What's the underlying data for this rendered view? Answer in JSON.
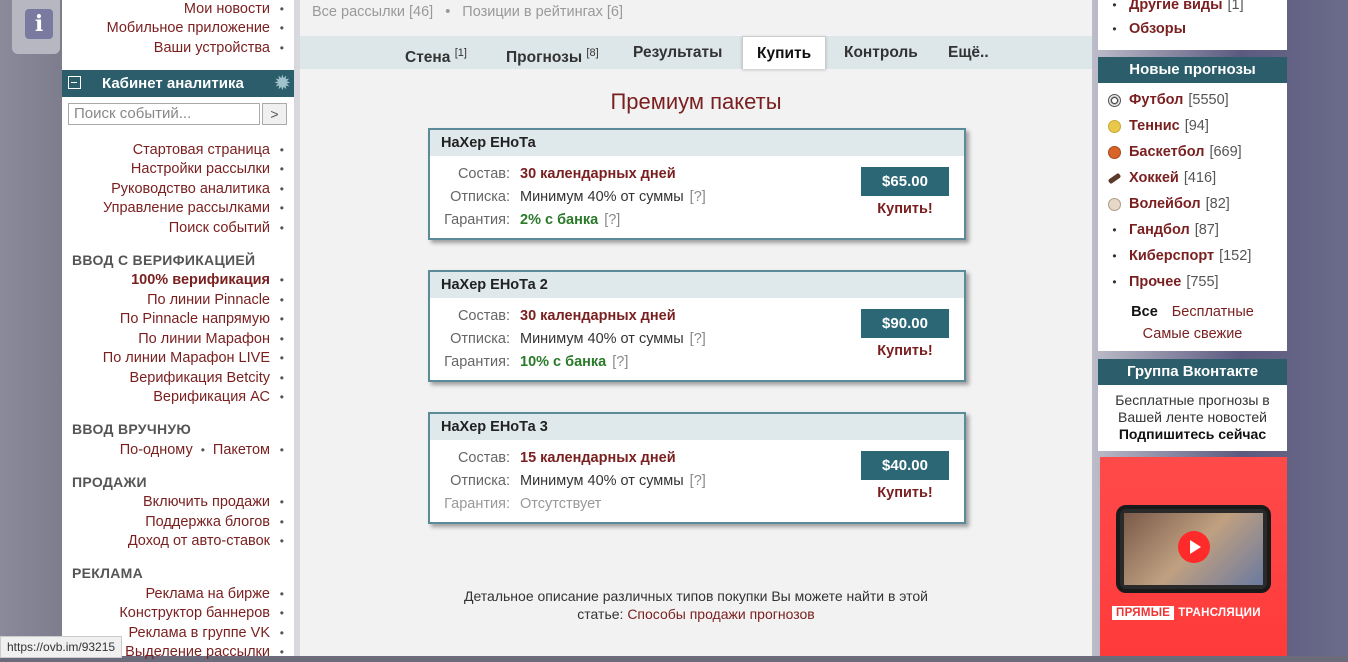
{
  "left": {
    "top_links": [
      "Мои новости",
      "Мобильное приложение",
      "Ваши устройства"
    ],
    "cabinet_title": "Кабинет аналитика",
    "search_placeholder": "Поиск событий...",
    "search_button": ">",
    "group1": [
      "Стартовая страница",
      "Настройки рассылки",
      "Руководство аналитика",
      "Управление рассылками",
      "Поиск событий"
    ],
    "sec_verify": "ВВОД С ВЕРИФИКАЦИЕЙ",
    "verify": [
      "100% верификация",
      "По линии Pinnacle",
      "По Pinnacle напрямую",
      "По линии Марафон",
      "По линии Марафон LIVE",
      "Верификация Betcity",
      "Верификация АС"
    ],
    "sec_manual": "ВВОД ВРУЧНУЮ",
    "manual": [
      "По-одному",
      "Пакетом"
    ],
    "sec_sales": "ПРОДАЖИ",
    "sales": [
      "Включить продажи",
      "Поддержка блогов",
      "Доход от авто-ставок"
    ],
    "sec_ads": "РЕКЛАМА",
    "ads": [
      "Реклама на бирже",
      "Конструктор баннеров",
      "Реклама в группе VK",
      "Выделение рассылки"
    ],
    "status_url": "https://ovb.im/93215"
  },
  "main": {
    "toplink1": "Все рассылки [46]",
    "toplink2": "Позиции в рейтингах [6]",
    "tabs": [
      {
        "label": "Стена",
        "sup": "[1]"
      },
      {
        "label": "Прогнозы",
        "sup": "[8]"
      },
      {
        "label": "Результаты",
        "sup": ""
      },
      {
        "label": "Купить",
        "sup": ""
      },
      {
        "label": "Контроль",
        "sup": ""
      },
      {
        "label": "Ещё..",
        "sup": ""
      }
    ],
    "page_title": "Премиум пакеты",
    "labels": {
      "content": "Состав:",
      "unsub": "Отписка:",
      "guarantee": "Гарантия:"
    },
    "cards": [
      {
        "name": "НаХер ЕНоТа",
        "content": "30 календарных дней",
        "unsub": "Минимум 40% от суммы",
        "q": "[?]",
        "guarantee": "2% с банка",
        "gq": "[?]",
        "price": "$65.00",
        "buy": "Купить!"
      },
      {
        "name": "НаХер ЕНоТа 2",
        "content": "30 календарных дней",
        "unsub": "Минимум 40% от суммы",
        "q": "[?]",
        "guarantee": "10% с банка",
        "gq": "[?]",
        "price": "$90.00",
        "buy": "Купить!"
      },
      {
        "name": "НаХер ЕНоТа 3",
        "content": "15 календарных дней",
        "unsub": "Минимум 40% от суммы",
        "q": "[?]",
        "guarantee": "Отсутствует",
        "gq": "",
        "price": "$40.00",
        "buy": "Купить!"
      }
    ],
    "note_text": "Детальное описание различных типов покупки Вы можете найти в этой статье: ",
    "note_link": "Способы продажи прогнозов"
  },
  "right": {
    "top_items": [
      {
        "name": "Другие виды",
        "count": "[1]"
      },
      {
        "name": "Обзоры",
        "count": ""
      }
    ],
    "new_title": "Новые прогнозы",
    "sports": [
      {
        "name": "Футбол",
        "count": "[5550]",
        "icon": "football-icon"
      },
      {
        "name": "Теннис",
        "count": "[94]",
        "icon": "tennis-icon"
      },
      {
        "name": "Баскетбол",
        "count": "[669]",
        "icon": "basketball-icon"
      },
      {
        "name": "Хоккей",
        "count": "[416]",
        "icon": "hockey-icon"
      },
      {
        "name": "Волейбол",
        "count": "[82]",
        "icon": "volleyball-icon"
      },
      {
        "name": "Гандбол",
        "count": "[87]",
        "icon": "bullet"
      },
      {
        "name": "Киберспорт",
        "count": "[152]",
        "icon": "bullet"
      },
      {
        "name": "Прочее",
        "count": "[755]",
        "icon": "bullet"
      }
    ],
    "filter_all": "Все",
    "filter_free": "Бесплатные",
    "filter_fresh": "Самые свежие",
    "vk_title": "Группа Вконтакте",
    "vk_text": "Бесплатные прогнозы в Вашей ленте новостей",
    "vk_link": "Подпишитесь сейчас",
    "ad_badge1": "ПРЯМЫЕ",
    "ad_badge2": "ТРАНСЛЯЦИИ"
  },
  "colors": {
    "accent": "#2b5d6b",
    "link": "#7a1f1f",
    "green": "#2a7a2a"
  }
}
